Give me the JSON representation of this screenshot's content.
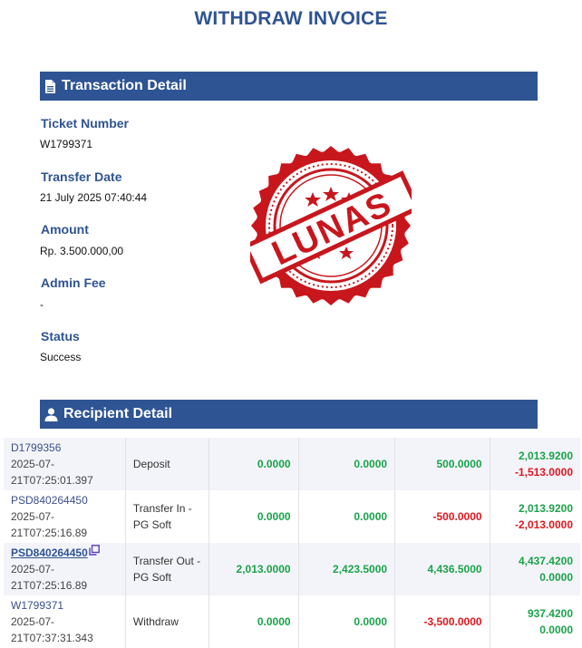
{
  "header": {
    "title": "WITHDRAW INVOICE"
  },
  "transaction_section": {
    "title": "Transaction Detail",
    "icon": "document-icon",
    "fields": [
      {
        "label": "Ticket Number",
        "value": "W1799371"
      },
      {
        "label": "Transfer Date",
        "value": "21 July 2025 07:40:44"
      },
      {
        "label": "Amount",
        "value": "Rp. 3.500.000,00"
      },
      {
        "label": "Admin Fee",
        "value": "-"
      },
      {
        "label": "Status",
        "value": "Success"
      }
    ]
  },
  "stamp": {
    "text": "LUNAS",
    "color": "#c8161d"
  },
  "recipient_section": {
    "title": "Recipient Detail",
    "icon": "user-icon"
  },
  "transactions": [
    {
      "id": "D1799356",
      "date_line1": "2025-07-",
      "date_line2": "21T07:25:01.397",
      "type": "Deposit",
      "col1": "0.0000",
      "col2": "0.0000",
      "col3": "500.0000",
      "bal1": "2,013.9200",
      "bal2": "-1,513.0000"
    },
    {
      "id": "PSD840264450",
      "date_line1": "2025-07-",
      "date_line2": "21T07:25:16.89",
      "type": "Transfer In - PG Soft",
      "col1": "0.0000",
      "col2": "0.0000",
      "col3": "-500.0000",
      "bal1": "2,013.9200",
      "bal2": "-2,013.0000"
    },
    {
      "id": "PSD840264450",
      "date_line1": "2025-07-",
      "date_line2": "21T07:25:16.89",
      "type": "Transfer Out - PG Soft",
      "col1": "2,013.0000",
      "col2": "2,423.5000",
      "col3": "4,436.5000",
      "bal1": "4,437.4200",
      "bal2": "0.0000"
    },
    {
      "id": "W1799371",
      "date_line1": "2025-07-",
      "date_line2": "21T07:37:31.343",
      "type": "Withdraw",
      "col1": "0.0000",
      "col2": "0.0000",
      "col3": "-3,500.0000",
      "bal1": "937.4200",
      "bal2": "0.0000"
    }
  ],
  "colors": {
    "accent": "#2f5493",
    "positive": "#1aa34a",
    "negative": "#e0161d"
  }
}
